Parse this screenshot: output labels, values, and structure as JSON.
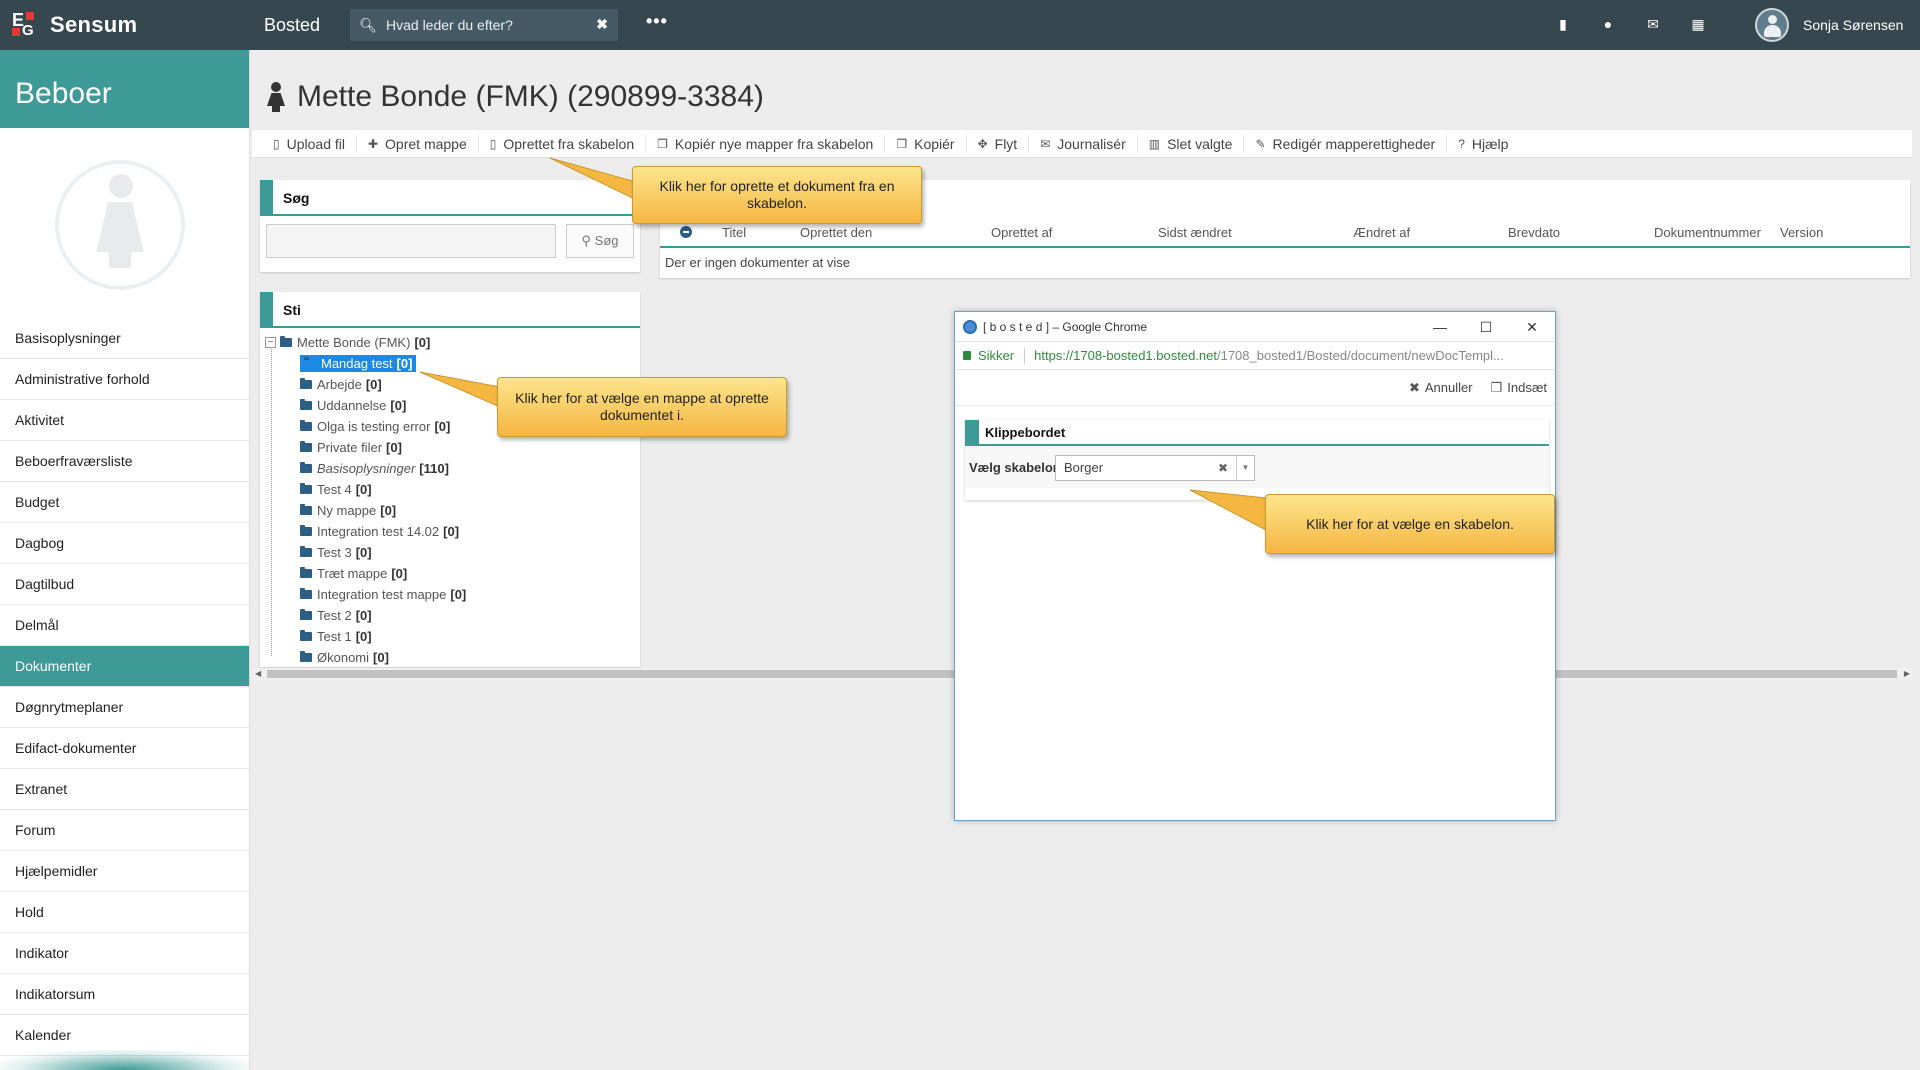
{
  "topbar": {
    "app_name": "Sensum",
    "module": "Bosted",
    "search_placeholder": "Hvad leder du efter?",
    "more": "•••",
    "user_name": "Sonja Sørensen"
  },
  "sidebar": {
    "header": "Beboer",
    "items": [
      {
        "label": "Basisoplysninger"
      },
      {
        "label": "Administrative forhold"
      },
      {
        "label": "Aktivitet"
      },
      {
        "label": "Beboerfraværsliste"
      },
      {
        "label": "Budget"
      },
      {
        "label": "Dagbog"
      },
      {
        "label": "Dagtilbud"
      },
      {
        "label": "Delmål"
      },
      {
        "label": "Dokumenter",
        "active": true
      },
      {
        "label": "Døgnrytmeplaner"
      },
      {
        "label": "Edifact-dokumenter"
      },
      {
        "label": "Extranet"
      },
      {
        "label": "Forum"
      },
      {
        "label": "Hjælpemidler"
      },
      {
        "label": "Hold"
      },
      {
        "label": "Indikator"
      },
      {
        "label": "Indikatorsum"
      },
      {
        "label": "Kalender"
      }
    ]
  },
  "page": {
    "title": "Mette Bonde (FMK) (290899-3384)"
  },
  "toolbar": {
    "upload": "Upload fil",
    "create_folder": "Opret mappe",
    "from_template": "Oprettet fra skabelon",
    "copy_folders": "Kopiér nye mapper fra skabelon",
    "copy": "Kopiér",
    "move": "Flyt",
    "journal": "Journalisér",
    "delete": "Slet valgte",
    "rights": "Redigér mapperettigheder",
    "help": "Hjælp"
  },
  "search_panel": {
    "title": "Søg",
    "button": "Søg"
  },
  "path_panel": {
    "title": "Sti",
    "root": {
      "name": "Mette Bonde (FMK)",
      "count": "[0]"
    },
    "folders": [
      {
        "name": "Mandag test",
        "count": "[0]"
      },
      {
        "name": "Arbejde",
        "count": "[0]"
      },
      {
        "name": "Uddannelse",
        "count": "[0]"
      },
      {
        "name": "Olga is testing error",
        "count": "[0]"
      },
      {
        "name": "Private filer",
        "count": "[0]"
      },
      {
        "name": "Basisoplysninger",
        "count": "[110]"
      },
      {
        "name": "Test 4",
        "count": "[0]"
      },
      {
        "name": "Ny mappe",
        "count": "[0]"
      },
      {
        "name": "Integration test 14.02",
        "count": "[0]"
      },
      {
        "name": "Test 3",
        "count": "[0]"
      },
      {
        "name": "Træt mappe",
        "count": "[0]"
      },
      {
        "name": "Integration test mappe",
        "count": "[0]"
      },
      {
        "name": "Test 2",
        "count": "[0]"
      },
      {
        "name": "Test 1",
        "count": "[0]"
      },
      {
        "name": "Økonomi",
        "count": "[0]"
      }
    ]
  },
  "docs_table": {
    "columns": [
      "Titel",
      "Oprettet den",
      "Oprettet af",
      "Sidst ændret",
      "Ændret af",
      "Brevdato",
      "Dokumentnummer",
      "Version"
    ],
    "empty": "Der er ingen dokumenter at vise"
  },
  "callouts": {
    "template": "Klik her for oprette et dokument fra en skabelon.",
    "folder": "Klik her for at vælge en mappe at oprette dokumentet i.",
    "select_template": "Klik her for at vælge en skabelon."
  },
  "popup": {
    "title": "[ b o s t e d ] – Google Chrome",
    "secure": "Sikker",
    "url_main": "https://1708-bosted1.bosted.net",
    "url_rest": "/1708_bosted1/Bosted/document/newDocTempl...",
    "cancel": "Annuller",
    "insert": "Indsæt",
    "panel_title": "Klippebordet",
    "select_label": "Vælg skabelon",
    "select_value": "Borger"
  },
  "colors": {
    "teal": "#3d9a96",
    "topbar": "#37474f",
    "callout": "#f5b642"
  }
}
